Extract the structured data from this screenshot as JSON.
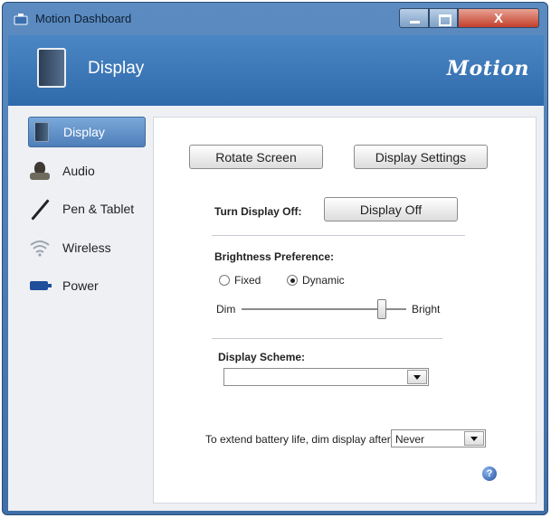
{
  "window": {
    "title": "Motion Dashboard",
    "close_label": "X"
  },
  "header": {
    "title": "Display",
    "brand": "Motion"
  },
  "sidebar": {
    "items": [
      {
        "label": "Display",
        "icon": "display-icon",
        "active": true
      },
      {
        "label": "Audio",
        "icon": "audio-icon",
        "active": false
      },
      {
        "label": "Pen & Tablet",
        "icon": "pen-icon",
        "active": false
      },
      {
        "label": "Wireless",
        "icon": "wireless-icon",
        "active": false
      },
      {
        "label": "Power",
        "icon": "battery-icon",
        "active": false
      }
    ]
  },
  "panel": {
    "rotate_screen": "Rotate Screen",
    "display_settings": "Display Settings",
    "turn_display_off_label": "Turn Display Off:",
    "display_off_button": "Display Off",
    "brightness_label": "Brightness Preference:",
    "radio_fixed": "Fixed",
    "radio_dynamic": "Dynamic",
    "brightness_mode": "Dynamic",
    "slider_min": "Dim",
    "slider_max": "Bright",
    "brightness_level": 0.85,
    "scheme_label": "Display Scheme:",
    "scheme_value": "",
    "dim_label": "To extend battery life, dim display after:",
    "dim_value": "Never",
    "help": "?"
  },
  "colors": {
    "accent": "#3f6fa6",
    "header": "#2f6aab",
    "close": "#c2402b"
  }
}
